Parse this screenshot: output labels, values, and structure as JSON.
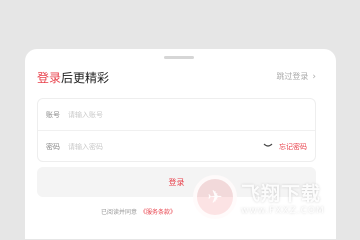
{
  "header": {
    "title_highlight": "登录",
    "title_rest": "后更精彩",
    "skip_label": "跳过登录"
  },
  "form": {
    "account": {
      "label": "账号",
      "placeholder": "请输入账号"
    },
    "password": {
      "label": "密码",
      "placeholder": "请输入密码",
      "forgot_label": "忘记密码"
    }
  },
  "login_button": "登录",
  "agreement": {
    "text": "已阅读并同意",
    "link": "《服务条款》"
  },
  "watermark": {
    "name": "飞翔下载",
    "url": "www.FXXZ.COM"
  },
  "colors": {
    "accent": "#e8414b",
    "background": "#e6e6e6",
    "sheet": "#ffffff"
  }
}
